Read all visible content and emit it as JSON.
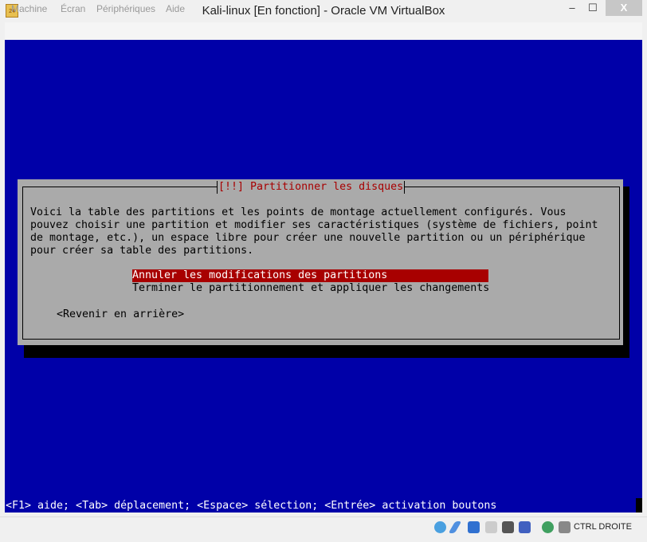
{
  "window": {
    "title": "Kali-linux [En fonction] - Oracle VM VirtualBox",
    "minimize": "‒",
    "maximize": "☐",
    "close": "X",
    "icon_label": "24"
  },
  "menu": [
    "Machine",
    "Écran",
    "Périphériques",
    "Aide"
  ],
  "dialog": {
    "title": "[!!] Partitionner les disques",
    "text": [
      "Voici la table des partitions et les points de montage actuellement configurés. Vous",
      "pouvez choisir une partition et modifier ses caractéristiques (système de fichiers, point",
      "de montage, etc.), un espace libre pour créer une nouvelle partition ou un périphérique",
      "pour créer sa table des partitions."
    ],
    "options": [
      "Annuler les modifications des partitions",
      "Terminer le partitionnement et appliquer les changements"
    ],
    "back": "<Revenir en arrière>"
  },
  "help": "<F1> aide; <Tab> déplacement; <Espace> sélection; <Entrée> activation boutons",
  "status": {
    "host_key": "CTRL DROITE",
    "icons": [
      "optical-drive-icon",
      "usb-icon",
      "network-icon",
      "shared-folder-icon",
      "display-icon",
      "virtualization-icon",
      "mouse-integration-icon",
      "keyboard-capture-icon"
    ]
  },
  "colors": {
    "screen": "#0000a8",
    "dialog": "#aaaaaa",
    "highlight": "#a80000"
  }
}
